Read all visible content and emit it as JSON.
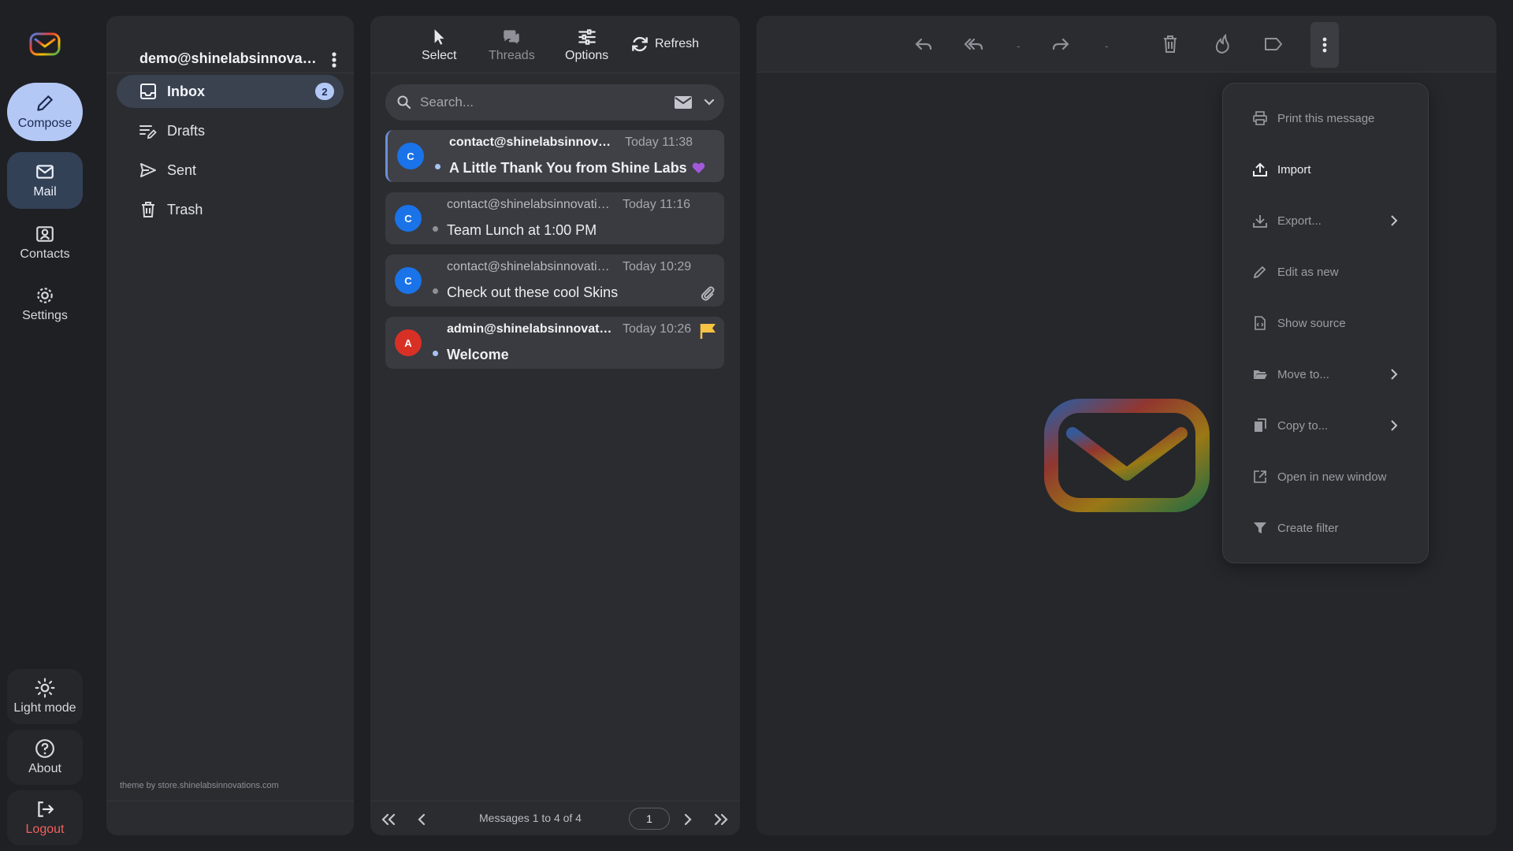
{
  "rail": {
    "compose": "Compose",
    "mail": "Mail",
    "contacts": "Contacts",
    "settings": "Settings",
    "light_mode": "Light mode",
    "about": "About",
    "logout": "Logout"
  },
  "account": {
    "email": "demo@shinelabsinnovatio...",
    "theme_note": "theme by store.shinelabsinnovations.com"
  },
  "folders": [
    {
      "label": "Inbox",
      "unread": "2",
      "icon": "inbox-icon"
    },
    {
      "label": "Drafts",
      "icon": "drafts-icon"
    },
    {
      "label": "Sent",
      "icon": "send-icon"
    },
    {
      "label": "Trash",
      "icon": "trash-icon"
    }
  ],
  "list_toolbar": {
    "select": "Select",
    "threads": "Threads",
    "options": "Options",
    "refresh": "Refresh"
  },
  "search": {
    "placeholder": "Search..."
  },
  "messages": [
    {
      "initial": "C",
      "from": "contact@shinelabsinnovatio...",
      "date": "Today 11:38",
      "subject": "A Little Thank You from Shine Labs",
      "unread": true,
      "avatar_color": "#1a73e8"
    },
    {
      "initial": "C",
      "from": "contact@shinelabsinnovatio...",
      "date": "Today 11:16",
      "subject": "Team Lunch at 1:00 PM",
      "unread": false,
      "avatar_color": "#1a73e8"
    },
    {
      "initial": "C",
      "from": "contact@shinelabsinnovatio...",
      "date": "Today 10:29",
      "subject": "Check out these cool Skins",
      "unread": false,
      "avatar_color": "#1a73e8"
    },
    {
      "initial": "A",
      "from": "admin@shinelabsinnovation...",
      "date": "Today 10:26",
      "subject": "Welcome",
      "unread": true,
      "avatar_color": "#d93025"
    }
  ],
  "pager": {
    "info": "Messages 1 to 4 of 4",
    "page": "1"
  },
  "pane_toolbar": {
    "dash1": "-",
    "dash2": "-"
  },
  "menu": {
    "print": "Print this message",
    "import": "Import",
    "export": "Export...",
    "edit_as_new": "Edit as new",
    "show_source": "Show source",
    "move_to": "Move to...",
    "copy_to": "Copy to...",
    "open_new_window": "Open in new window",
    "create_filter": "Create filter"
  },
  "colors": {
    "accent": "#b4c8f6",
    "flag": "#f6c343",
    "logout": "#f2605a"
  }
}
